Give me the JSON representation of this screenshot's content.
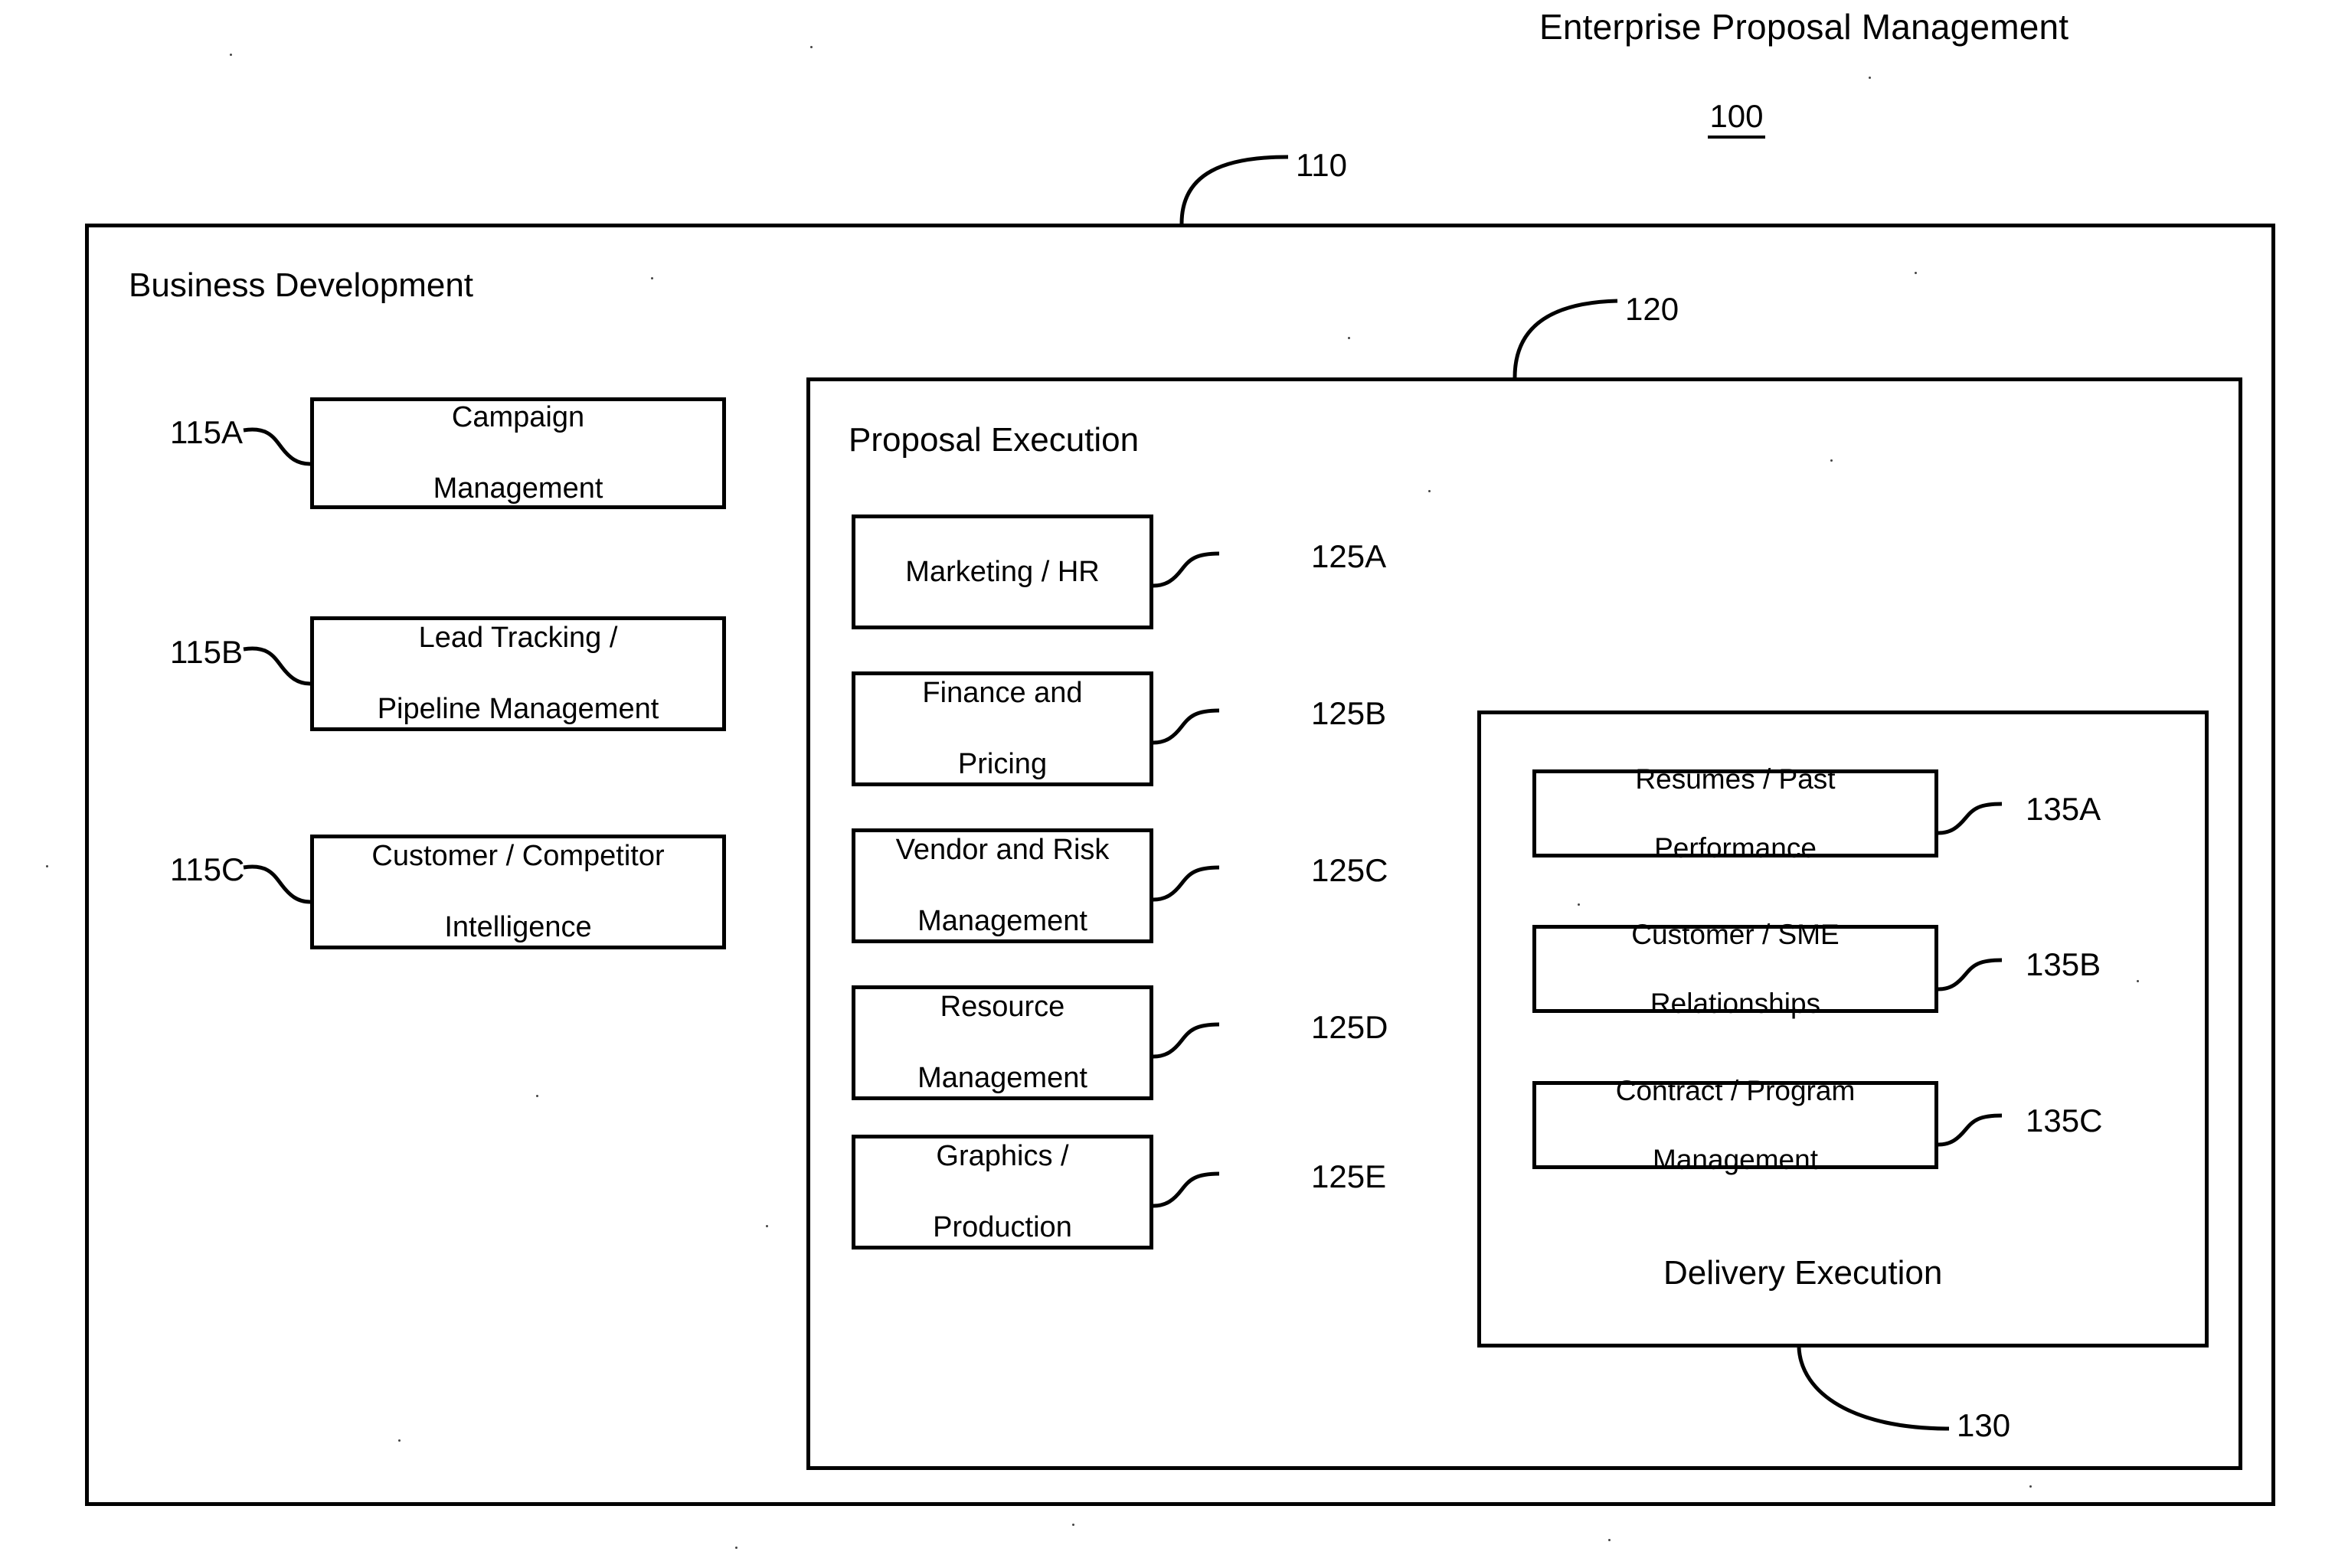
{
  "figure": {
    "title": "Enterprise Proposal Management",
    "number": "100"
  },
  "outer": {
    "label": "Business Development",
    "ref": "110",
    "items": [
      {
        "ref": "115A",
        "label_line1": "Campaign",
        "label_line2": "Management"
      },
      {
        "ref": "115B",
        "label_line1": "Lead Tracking /",
        "label_line2": "Pipeline Management"
      },
      {
        "ref": "115C",
        "label_line1": "Customer / Competitor",
        "label_line2": "Intelligence"
      }
    ]
  },
  "proposal_execution": {
    "label": "Proposal Execution",
    "ref": "120",
    "items": [
      {
        "ref": "125A",
        "label_line1": "Marketing / HR",
        "label_line2": ""
      },
      {
        "ref": "125B",
        "label_line1": "Finance and",
        "label_line2": "Pricing"
      },
      {
        "ref": "125C",
        "label_line1": "Vendor and Risk",
        "label_line2": "Management"
      },
      {
        "ref": "125D",
        "label_line1": "Resource",
        "label_line2": "Management"
      },
      {
        "ref": "125E",
        "label_line1": "Graphics /",
        "label_line2": "Production"
      }
    ]
  },
  "delivery_execution": {
    "label": "Delivery Execution",
    "ref": "130",
    "items": [
      {
        "ref": "135A",
        "label_line1": "Resumes / Past",
        "label_line2": "Performance"
      },
      {
        "ref": "135B",
        "label_line1": "Customer / SME",
        "label_line2": "Relationships"
      },
      {
        "ref": "135C",
        "label_line1": "Contract / Program",
        "label_line2": "Management"
      }
    ]
  },
  "colors": {
    "ink": "#000000",
    "paper": "#ffffff"
  }
}
